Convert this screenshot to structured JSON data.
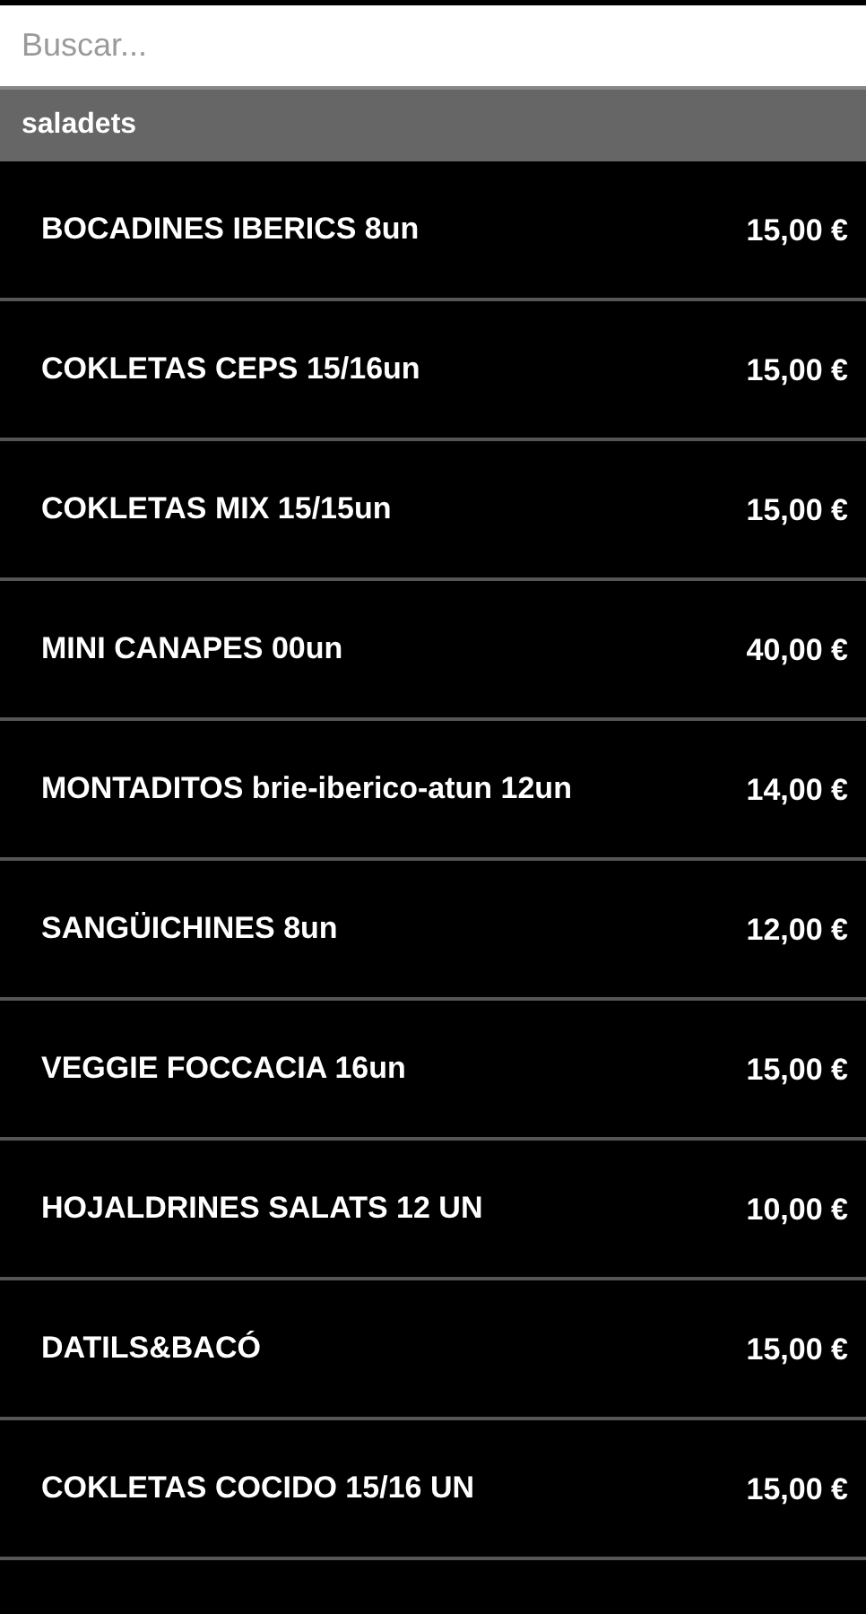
{
  "search": {
    "placeholder": "Buscar..."
  },
  "category": {
    "title": "saladets"
  },
  "products": [
    {
      "name": "BOCADINES IBERICS 8un",
      "price": "15,00 €"
    },
    {
      "name": "COKLETAS CEPS 15/16un",
      "price": "15,00 €"
    },
    {
      "name": "COKLETAS MIX 15/15un",
      "price": "15,00 €"
    },
    {
      "name": "MINI CANAPES 00un",
      "price": "40,00 €"
    },
    {
      "name": "MONTADITOS brie-iberico-atun 12un",
      "price": "14,00 €"
    },
    {
      "name": "SANGÜICHINES 8un",
      "price": "12,00 €"
    },
    {
      "name": "VEGGIE FOCCACIA 16un",
      "price": "15,00 €"
    },
    {
      "name": "HOJALDRINES SALATS 12 UN",
      "price": "10,00 €"
    },
    {
      "name": "DATILS&BACÓ",
      "price": "15,00 €"
    },
    {
      "name": "COKLETAS COCIDO 15/16 UN",
      "price": "15,00 €"
    }
  ]
}
